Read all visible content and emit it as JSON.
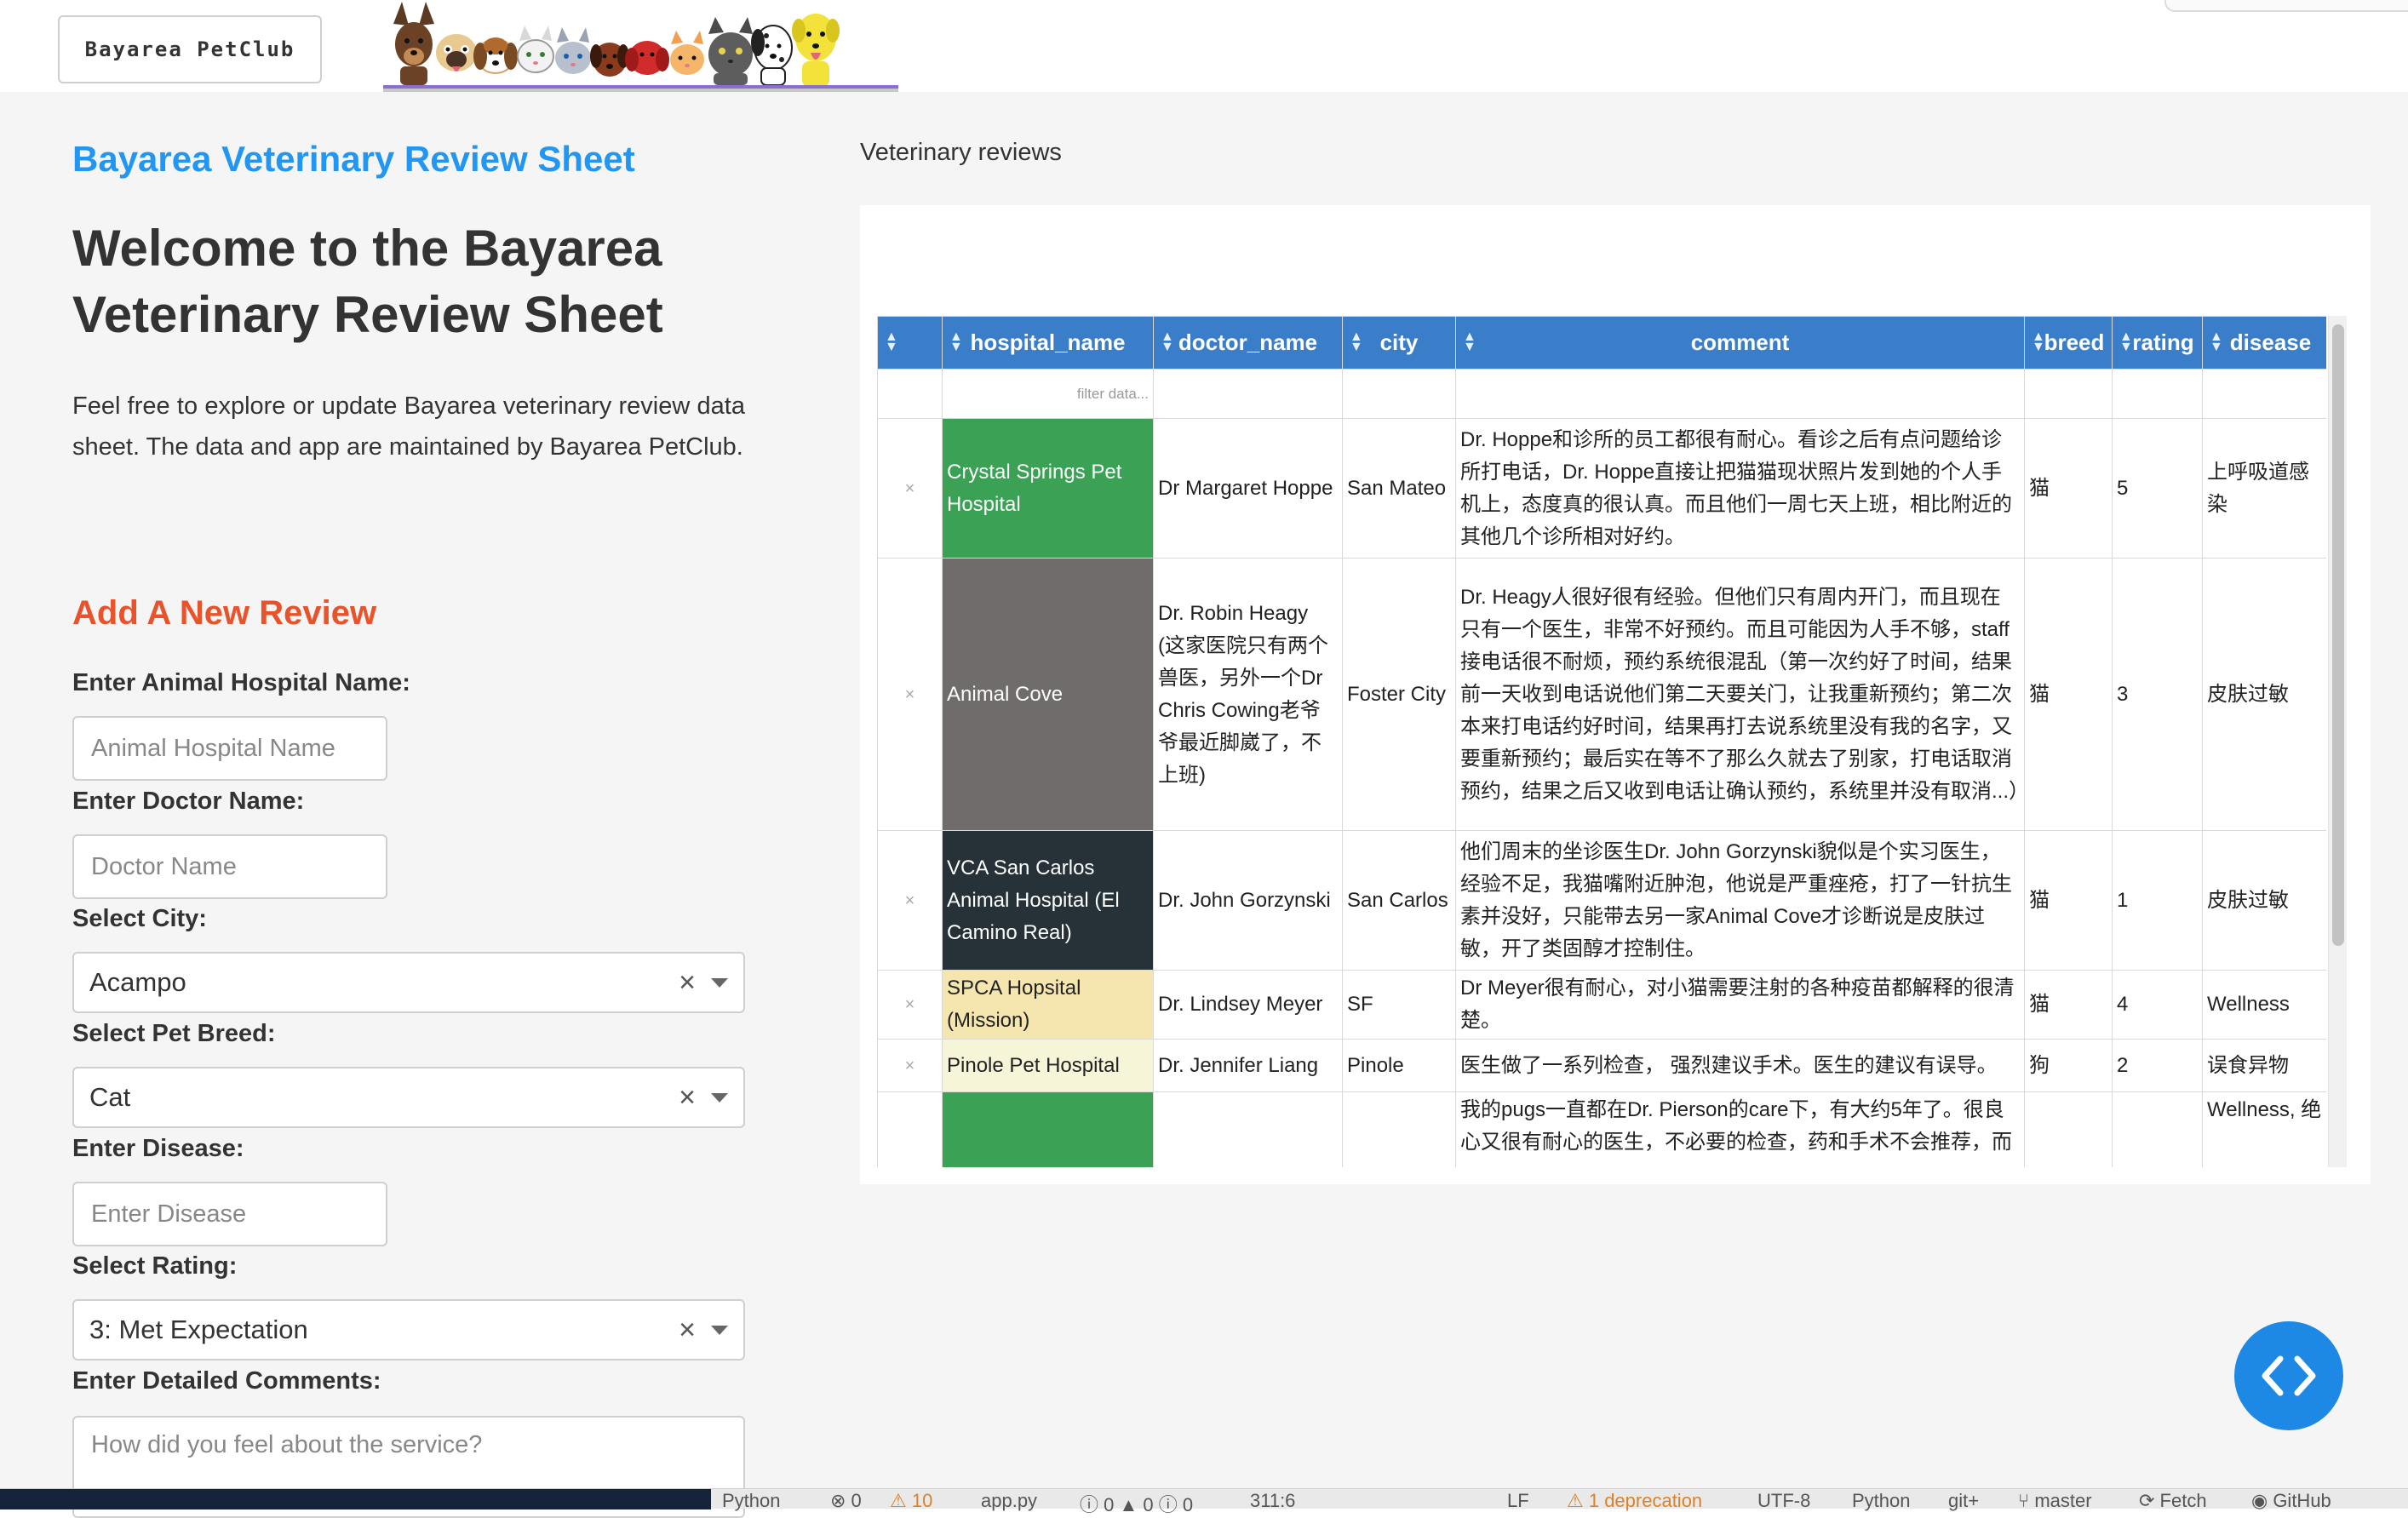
{
  "header": {
    "brand_label": "Bayarea PetClub",
    "banner_icon": "pets-lineup-banner"
  },
  "sidebar": {
    "subtitle": "Bayarea Veterinary Review Sheet",
    "welcome_title": "Welcome to the Bayarea Veterinary Review Sheet",
    "intro": "Feel free to explore or update Bayarea veterinary review data sheet. The data and app are maintained by Bayarea PetClub.",
    "form_title": "Add A New Review",
    "hospital_label": "Enter Animal Hospital Name:",
    "hospital_placeholder": "Animal Hospital Name",
    "doctor_label": "Enter Doctor Name:",
    "doctor_placeholder": "Doctor Name",
    "city_label": "Select City:",
    "city_value": "Acampo",
    "breed_label": "Select Pet Breed:",
    "breed_value": "Cat",
    "disease_label": "Enter Disease:",
    "disease_placeholder": "Enter Disease",
    "rating_label": "Select Rating:",
    "rating_value": "3: Met Expectation",
    "comments_label": "Enter Detailed Comments:",
    "comments_placeholder": "How did you feel about the service?"
  },
  "main": {
    "title": "Veterinary reviews",
    "filter_placeholder": "filter data...",
    "columns": [
      "hospital_name",
      "doctor_name",
      "city",
      "comment",
      "breed",
      "rating",
      "disease"
    ],
    "rows": [
      {
        "remove": "×",
        "hospital_name": "Crystal Springs Pet Hospital",
        "doctor_name": "Dr Margaret Hoppe",
        "city": "San Mateo",
        "comment": "Dr. Hoppe和诊所的员工都很有耐心。看诊之后有点问题给诊所打电话，Dr. Hoppe直接让把猫猫现状照片发到她的个人手机上，态度真的很认真。而且他们一周七天上班，相比附近的其他几个诊所相对好约。",
        "breed": "猫",
        "rating": "5",
        "disease": "上呼吸道感染",
        "color": "#3ba154"
      },
      {
        "remove": "×",
        "hospital_name": "Animal Cove",
        "doctor_name": "Dr. Robin Heagy (这家医院只有两个兽医，另外一个Dr Chris Cowing老爷爷最近脚崴了，不上班)",
        "city": "Foster City",
        "comment": "Dr. Heagy人很好很有经验。但他们只有周内开门，而且现在只有一个医生，非常不好预约。而且可能因为人手不够，staff接电话很不耐烦，预约系统很混乱（第一次约好了时间，结果前一天收到电话说他们第二天要关门，让我重新预约；第二次本来打电话约好时间，结果再打去说系统里没有我的名字，又要重新预约；最后实在等不了那么久就去了别家，打电话取消预约，结果之后又收到电话让确认预约，系统里并没有取消...）",
        "breed": "猫",
        "rating": "3",
        "disease": "皮肤过敏",
        "color": "#706c6c"
      },
      {
        "remove": "×",
        "hospital_name": "VCA San Carlos Animal Hospital (El Camino Real)",
        "doctor_name": "Dr. John Gorzynski",
        "city": "San Carlos",
        "comment": "他们周末的坐诊医生Dr. John Gorzynski貌似是个实习医生，经验不足，我猫嘴附近肿泡，他说是严重痤疮，打了一针抗生素并没好，只能带去另一家Animal Cove才诊断说是皮肤过敏，开了类固醇才控制住。",
        "breed": "猫",
        "rating": "1",
        "disease": "皮肤过敏",
        "color": "#263238"
      },
      {
        "remove": "×",
        "hospital_name": "SPCA Hopsital (Mission)",
        "doctor_name": "Dr. Lindsey Meyer",
        "city": "SF",
        "comment": "Dr Meyer很有耐心，对小猫需要注射的各种疫苗都解释的很清楚。",
        "breed": "猫",
        "rating": "4",
        "disease": "Wellness",
        "color": "#f5e6b0"
      },
      {
        "remove": "×",
        "hospital_name": "Pinole Pet Hospital",
        "doctor_name": "Dr. Jennifer Liang",
        "city": "Pinole",
        "comment": "医生做了一系列检查， 强烈建议手术。医生的建议有误导。",
        "breed": "狗",
        "rating": "2",
        "disease": "误食异物",
        "color": "#f7f5d8"
      },
      {
        "remove": "",
        "hospital_name": "",
        "doctor_name": "",
        "city": "",
        "comment": "我的pugs一直都在Dr. Pierson的care下，有大约5年了。很良心又很有耐心的医生，不必要的检查，药和手术不会推荐，而",
        "breed": "",
        "rating": "",
        "disease": "Wellness, 绝",
        "color": "#3ba154"
      }
    ]
  },
  "statusbar": {
    "language": "Python",
    "errors": "0",
    "warnings": "10",
    "file": "app.py",
    "problems": "0 ▲ 0 ⓘ 0",
    "position": "311:6",
    "line_ending": "LF",
    "deprecation": "1 deprecation",
    "encoding": "UTF-8",
    "language2": "Python",
    "git": "git+",
    "branch": "master",
    "fetch": "Fetch",
    "github": "GitHub"
  },
  "colors": {
    "accent_blue": "#2196f3",
    "accent_orange": "#e9532b",
    "table_header": "#3a7dc8",
    "fab": "#1e88e5"
  }
}
